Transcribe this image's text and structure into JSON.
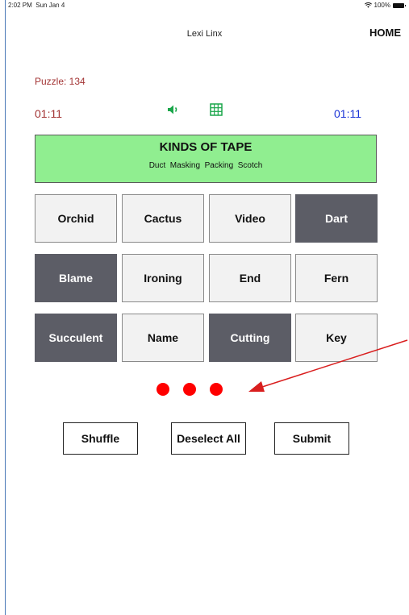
{
  "status_bar": {
    "time": "2:02 PM",
    "date": "Sun Jan 4",
    "battery": "100%",
    "wifi_icon": "wifi-icon"
  },
  "header": {
    "title": "Lexi Linx",
    "home_label": "HOME"
  },
  "puzzle": {
    "label": "Puzzle: 134"
  },
  "timers": {
    "left": "01:11",
    "right": "01:11",
    "left_color": "#a33434",
    "right_color": "#1a33d6"
  },
  "icons": {
    "sound": "speaker-icon",
    "grid": "grid-icon"
  },
  "category": {
    "title": "KINDS OF TAPE",
    "words": "Duct  Masking  Packing  Scotch",
    "color": "#90ee90"
  },
  "tiles": [
    {
      "label": "Orchid",
      "selected": false
    },
    {
      "label": "Cactus",
      "selected": false
    },
    {
      "label": "Video",
      "selected": false
    },
    {
      "label": "Dart",
      "selected": true
    },
    {
      "label": "Blame",
      "selected": true
    },
    {
      "label": "Ironing",
      "selected": false
    },
    {
      "label": "End",
      "selected": false
    },
    {
      "label": "Fern",
      "selected": false
    },
    {
      "label": "Succulent",
      "selected": true
    },
    {
      "label": "Name",
      "selected": false
    },
    {
      "label": "Cutting",
      "selected": true
    },
    {
      "label": "Key",
      "selected": false
    }
  ],
  "mistakes_remaining": 3,
  "annotation": {
    "arrow_color": "#d91e1e"
  },
  "actions": {
    "shuffle": "Shuffle",
    "deselect_all": "Deselect All",
    "submit": "Submit"
  }
}
